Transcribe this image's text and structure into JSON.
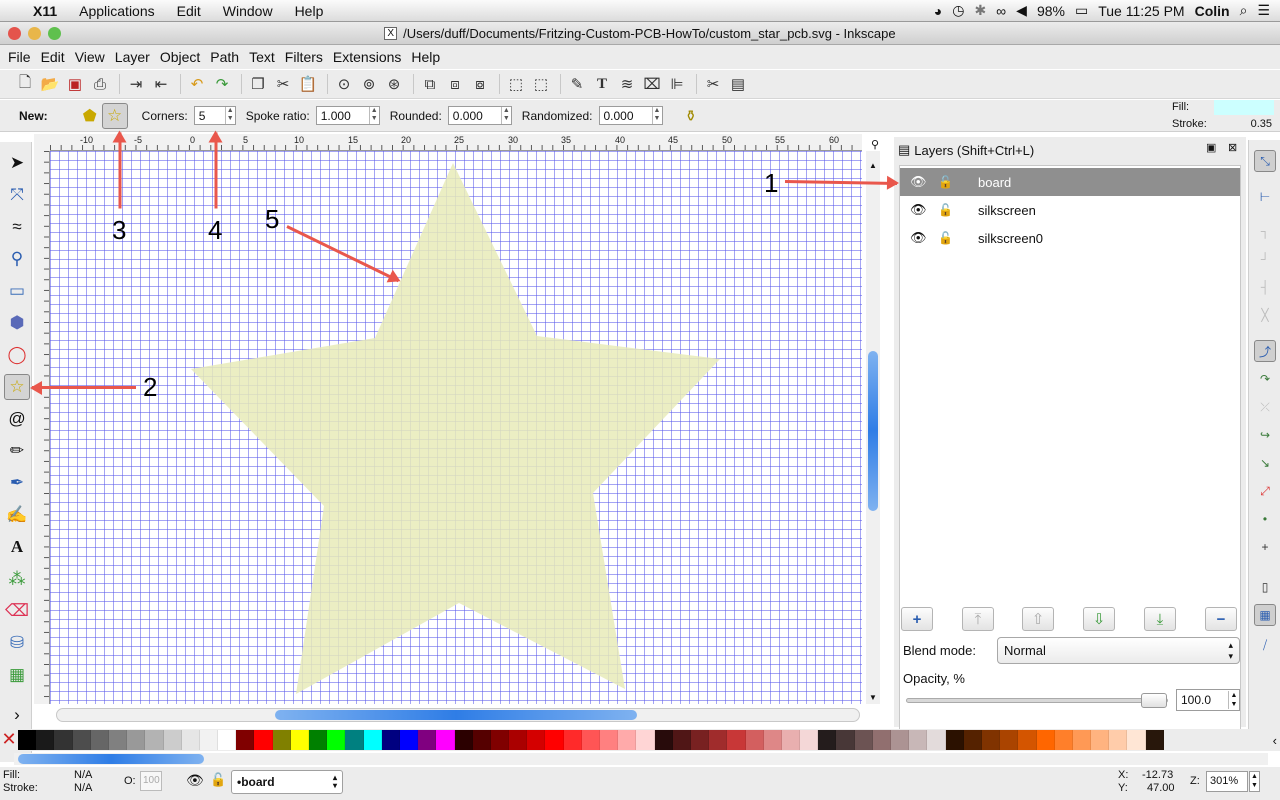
{
  "mac_menubar": {
    "app": "X11",
    "items": [
      "Applications",
      "Edit",
      "Window",
      "Help"
    ],
    "battery": "98%",
    "clock": "Tue 11:25 PM",
    "user": "Colin"
  },
  "window": {
    "title": "/Users/duff/Documents/Fritzing-Custom-PCB-HowTo/custom_star_pcb.svg - Inkscape"
  },
  "menu": {
    "file": "File",
    "edit": "Edit",
    "view": "View",
    "layer": "Layer",
    "object": "Object",
    "path": "Path",
    "text": "Text",
    "filters": "Filters",
    "extensions": "Extensions",
    "help": "Help"
  },
  "tool_controls": {
    "new_label": "New:",
    "corners_label": "Corners:",
    "corners_value": "5",
    "spoke_label": "Spoke ratio:",
    "spoke_value": "1.000",
    "rounded_label": "Rounded:",
    "rounded_value": "0.000",
    "randomized_label": "Randomized:",
    "randomized_value": "0.000",
    "fill_label": "Fill:",
    "stroke_label": "Stroke:",
    "stroke_value": "0.35",
    "fill_color": "#ccffff"
  },
  "ruler_top_labels": [
    "-10",
    "-5",
    "0",
    "5",
    "10",
    "15",
    "20",
    "25",
    "30",
    "35",
    "40",
    "45",
    "50",
    "55",
    "60"
  ],
  "layers_dialog": {
    "title": "Layers (Shift+Ctrl+L)",
    "layers": [
      {
        "name": "board",
        "selected": true
      },
      {
        "name": "silkscreen",
        "selected": false
      },
      {
        "name": "silkscreen0",
        "selected": false
      }
    ],
    "blend_label": "Blend mode:",
    "blend_value": "Normal",
    "opacity_label": "Opacity, %",
    "opacity_value": "100.0"
  },
  "annotations": [
    "1",
    "2",
    "3",
    "4",
    "5"
  ],
  "star": {
    "fill": "#e8ebb8"
  },
  "palette": [
    "#000000",
    "#1a1a1a",
    "#333333",
    "#4d4d4d",
    "#666666",
    "#808080",
    "#999999",
    "#b3b3b3",
    "#cccccc",
    "#e6e6e6",
    "#f2f2f2",
    "#ffffff",
    "#800000",
    "#ff0000",
    "#808000",
    "#ffff00",
    "#008000",
    "#00ff00",
    "#008080",
    "#00ffff",
    "#000080",
    "#0000ff",
    "#800080",
    "#ff00ff",
    "#2b0000",
    "#550000",
    "#800000",
    "#aa0000",
    "#d40000",
    "#ff0000",
    "#ff2a2a",
    "#ff5555",
    "#ff8080",
    "#ffaaaa",
    "#ffd5d5",
    "#280b0b",
    "#501616",
    "#782121",
    "#a02c2c",
    "#c83737",
    "#d35f5f",
    "#de8787",
    "#e9afaf",
    "#f4d7d7",
    "#241c1c",
    "#483737",
    "#6c5353",
    "#916f6f",
    "#ac9393",
    "#c8b7b7",
    "#e3dbdb",
    "#2b1100",
    "#552200",
    "#803300",
    "#aa4400",
    "#d45500",
    "#ff6600",
    "#ff7f2a",
    "#ff9955",
    "#ffb380",
    "#ffccaa",
    "#ffe6d5",
    "#28170b"
  ],
  "status": {
    "fill_label": "Fill:",
    "fill_value": "N/A",
    "stroke_label": "Stroke:",
    "stroke_value": "N/A",
    "o_label": "O:",
    "o_value": "100",
    "layer_value": "•board",
    "x_label": "X:",
    "x_value": "-12.73",
    "y_label": "Y:",
    "y_value": "47.00",
    "z_label": "Z:",
    "zoom": "301%"
  }
}
